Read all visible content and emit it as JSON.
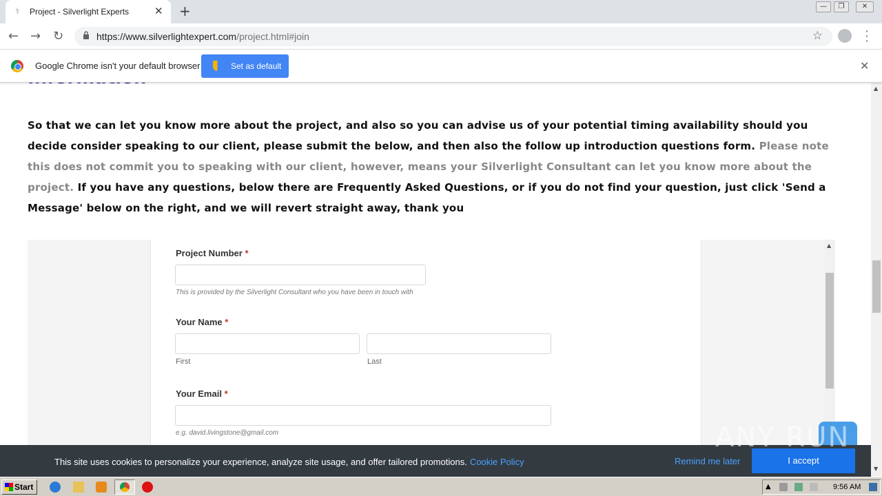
{
  "browser": {
    "tab_title": "Project - Silverlight Experts",
    "new_tab": "+",
    "url_host": "https://www.silverlightexpert.com",
    "url_path": "/project.html#join"
  },
  "infobar": {
    "message": "Google Chrome isn't your default browser",
    "set_default_label": "Set as default"
  },
  "page": {
    "heading": "Information",
    "intro_bold_1": "So that we can let you know more about the project, and also so you can advise us of your potential timing availability should you decide consider speaking to our client, please submit the below, and then also the follow up introduction questions form.",
    "intro_note": "Please note this does not commit you to speaking with our client, however, means your Silverlight Consultant can let you know more about the project.",
    "intro_bold_2": "If you have any questions, below there are Frequently Asked Questions, or if you do not find your question, just click 'Send a Message' below on the right, and we will revert straight away, thank you"
  },
  "form": {
    "required_mark": "*",
    "project_number_label": "Project Number",
    "project_number_hint": "This is provided by the Silverlight Consultant who you have been in touch with",
    "name_label": "Your Name",
    "first_sub": "First",
    "last_sub": "Last",
    "email_label": "Your Email",
    "email_hint": "e.g. david.livingstone@gmail.com"
  },
  "cookie": {
    "text": "This site uses cookies to personalize your experience, analyze site usage, and offer tailored promotions.",
    "policy_link": "Cookie Policy",
    "remind_label": "Remind me later",
    "accept_label": "I accept"
  },
  "watermark": "ANY RUN",
  "taskbar": {
    "start_label": "Start",
    "clock": "9:56 AM"
  },
  "colors": {
    "heading": "#1a1a9a",
    "set_default_bg": "#4285f4",
    "cookie_bg": "#333a40",
    "accept_bg": "#1a73e8",
    "link": "#4aa3ff"
  }
}
